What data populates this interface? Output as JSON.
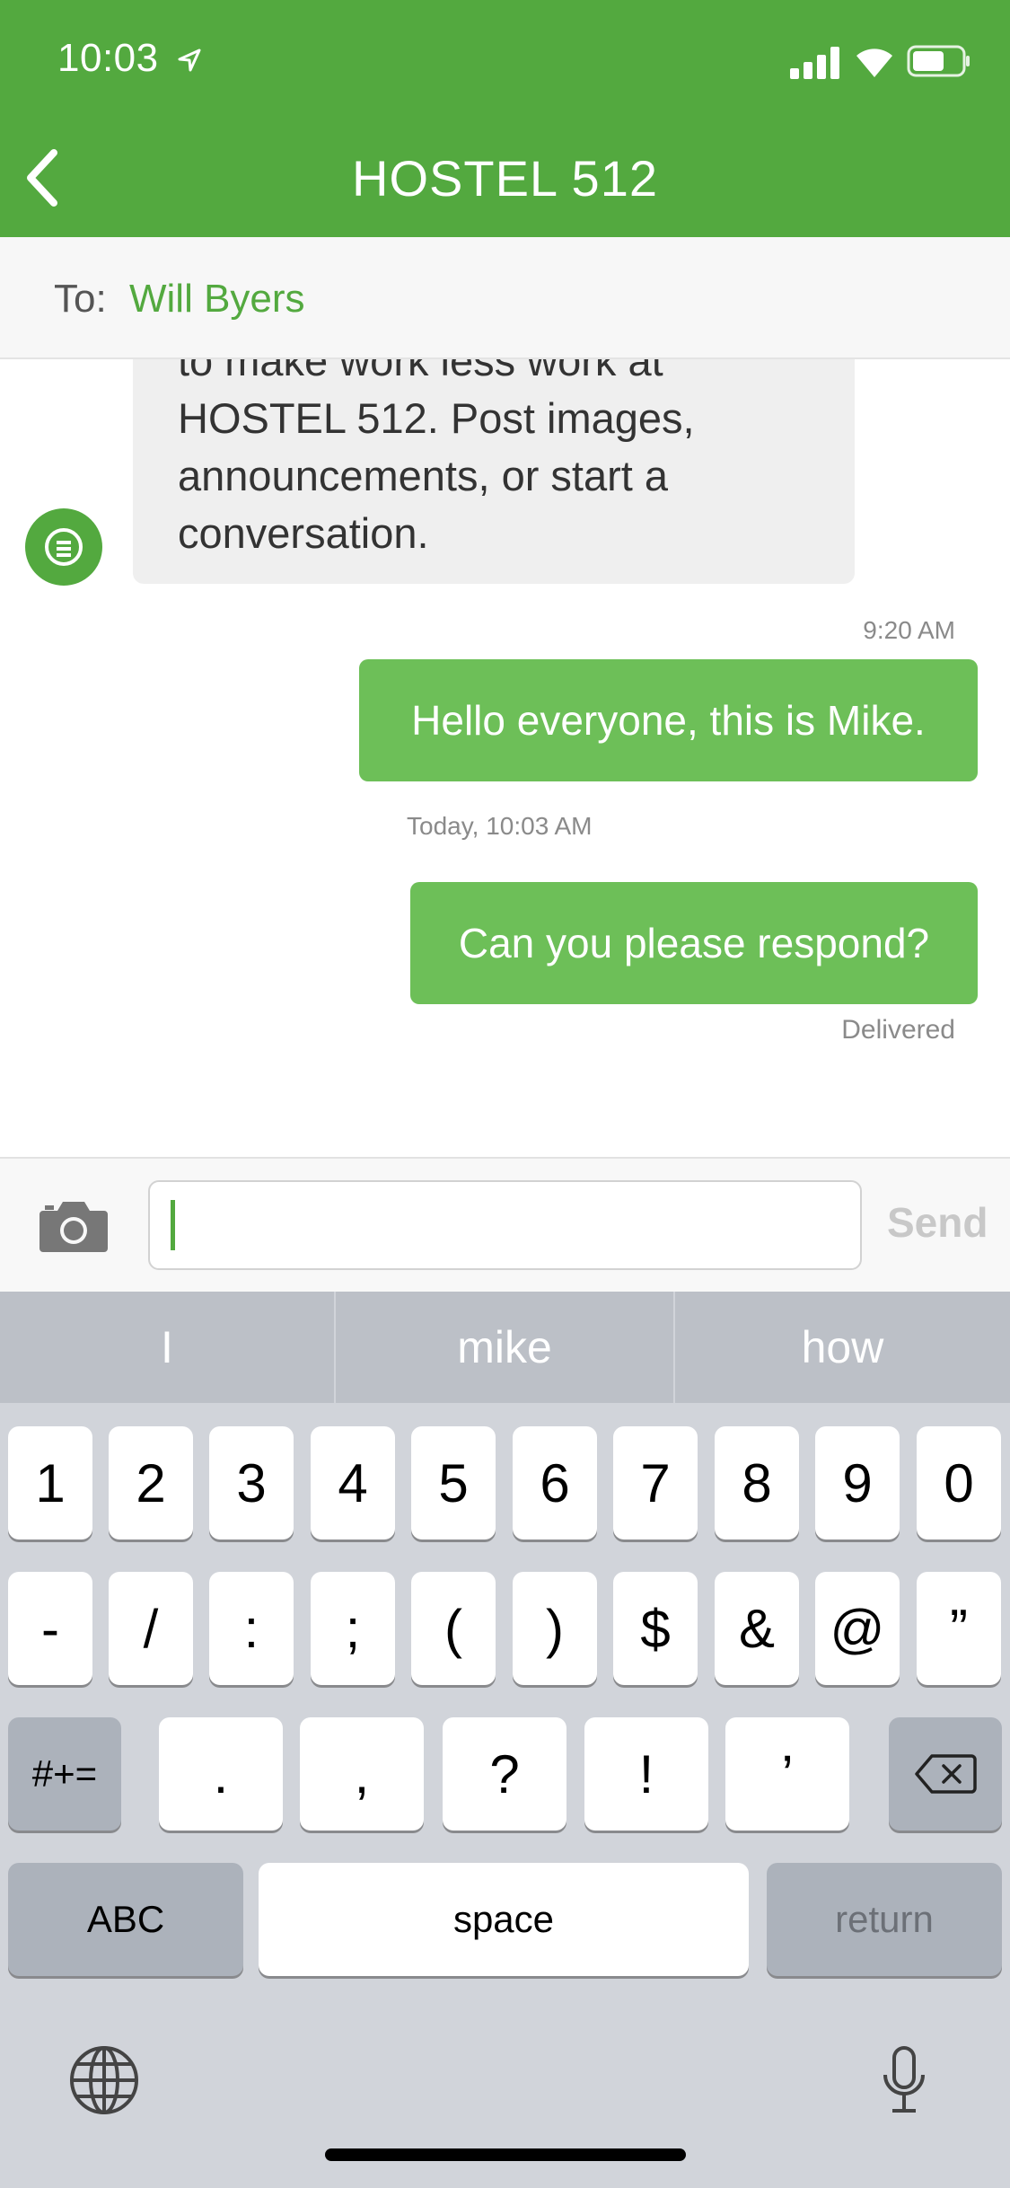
{
  "status_bar": {
    "time": "10:03"
  },
  "header": {
    "title": "HOSTEL 512"
  },
  "recipient": {
    "label": "To:",
    "name": "Will Byers"
  },
  "messages": {
    "incoming_lines": [
      "to make work less work at",
      "HOSTEL 512. Post images,",
      "announcements, or start a",
      "conversation."
    ],
    "time_1": "9:20 AM",
    "outgoing_1": "Hello everyone, this is Mike.",
    "time_2": "Today, 10:03 AM",
    "outgoing_2": "Can you please respond?",
    "status": "Delivered"
  },
  "composer": {
    "input_value": "",
    "send_label": "Send"
  },
  "keyboard": {
    "suggestions": [
      "I",
      "mike",
      "how"
    ],
    "row1": [
      "1",
      "2",
      "3",
      "4",
      "5",
      "6",
      "7",
      "8",
      "9",
      "0"
    ],
    "row2": [
      "-",
      "/",
      ":",
      ";",
      "(",
      ")",
      "$",
      "&",
      "@",
      "”"
    ],
    "row3_left": "#+=",
    "row3": [
      ".",
      ",",
      "?",
      "!",
      "’"
    ],
    "abc": "ABC",
    "space": "space",
    "return": "return"
  },
  "colors": {
    "brand_green": "#53a93f",
    "bubble_green": "#6dbf58"
  },
  "icons": [
    "location-arrow-icon",
    "signal-icon",
    "wifi-icon",
    "battery-icon",
    "back-chevron-icon",
    "bot-avatar-icon",
    "camera-icon",
    "backspace-icon",
    "globe-icon",
    "microphone-icon"
  ]
}
